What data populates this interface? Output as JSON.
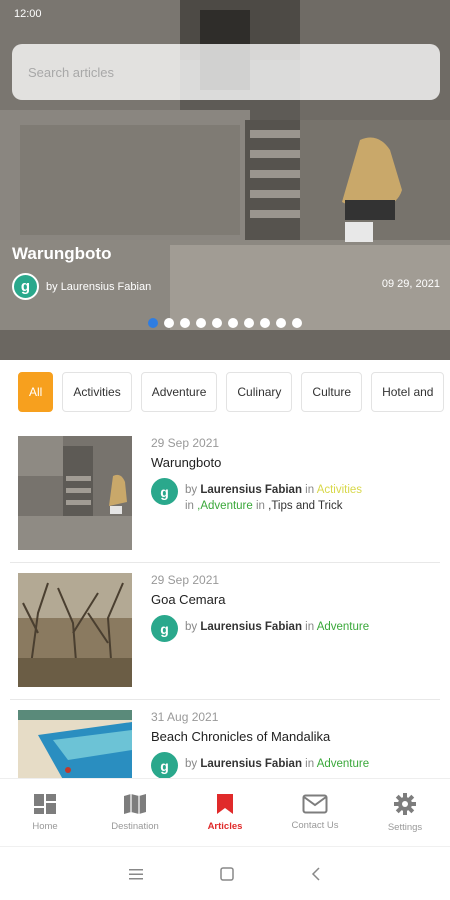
{
  "status": {
    "time": "12:00"
  },
  "search": {
    "placeholder": "Search articles"
  },
  "hero": {
    "title": "Warungboto",
    "author_prefix": "by",
    "author": "Laurensius Fabian",
    "date": "09 29, 2021",
    "slide_count": 10,
    "active_slide": 0
  },
  "categories": [
    "All",
    "Activities",
    "Adventure",
    "Culinary",
    "Culture",
    "Hotel and"
  ],
  "articles": [
    {
      "date": "29 Sep 2021",
      "title": "Warungboto",
      "by": "by",
      "author": "Laurensius Fabian",
      "in1": "in",
      "cat1": "Activities",
      "in2": "in",
      "cat2": ",Adventure",
      "in3": "in",
      "cat3": ",Tips and Trick"
    },
    {
      "date": "29 Sep 2021",
      "title": "Goa Cemara",
      "by": "by",
      "author": "Laurensius Fabian",
      "in1": "in",
      "cat1": "Adventure"
    },
    {
      "date": "31 Aug 2021",
      "title": "Beach Chronicles of Mandalika",
      "by": "by",
      "author": "Laurensius Fabian",
      "in1": "in",
      "cat1": "Adventure"
    }
  ],
  "avatar_letter": "g",
  "nav": [
    {
      "label": "Home",
      "icon": "dashboard-icon"
    },
    {
      "label": "Destination",
      "icon": "map-icon"
    },
    {
      "label": "Articles",
      "icon": "bookmark-icon"
    },
    {
      "label": "Contact Us",
      "icon": "mail-icon"
    },
    {
      "label": "Settings",
      "icon": "gear-icon"
    }
  ],
  "colors": {
    "accent": "#f7a01e",
    "active_nav": "#e02a2a",
    "dot_active": "#2f7de1",
    "avatar": "#2aa88c",
    "category_yellow": "#d8d84a",
    "category_green": "#3aa83a"
  }
}
